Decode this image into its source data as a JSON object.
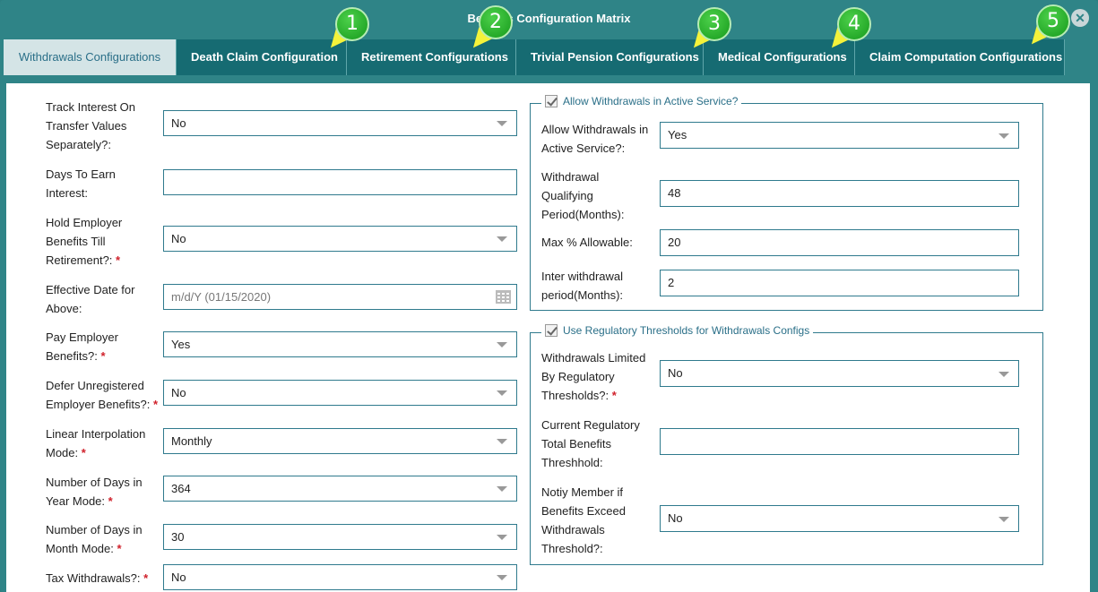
{
  "window": {
    "title": "Benefits Configuration Matrix",
    "close_glyph": "✕"
  },
  "tabs": [
    {
      "label": "Withdrawals Configurations"
    },
    {
      "label": "Death Claim Configuration"
    },
    {
      "label": "Retirement Configurations"
    },
    {
      "label": "Trivial Pension Configurations"
    },
    {
      "label": "Medical Configurations"
    },
    {
      "label": "Claim Computation Configurations"
    }
  ],
  "callouts": [
    "1",
    "2",
    "3",
    "4",
    "5"
  ],
  "left": {
    "track_interest": {
      "label": "Track Interest On Transfer Values Separately?:",
      "value": "No"
    },
    "days_to_earn": {
      "label": "Days To Earn Interest:",
      "value": ""
    },
    "hold_employer": {
      "label": "Hold Employer Benefits Till Retirement?:",
      "value": "No"
    },
    "effective_date": {
      "label": "Effective Date for Above:",
      "placeholder": "m/d/Y (01/15/2020)"
    },
    "pay_employer": {
      "label": "Pay Employer Benefits?:",
      "value": "Yes"
    },
    "defer_unregistered": {
      "label": "Defer Unregistered Employer Benefits?:",
      "value": "No"
    },
    "linear_interp": {
      "label": "Linear Interpolation Mode:",
      "value": "Monthly"
    },
    "days_in_year": {
      "label": "Number of Days in Year Mode:",
      "value": "364"
    },
    "days_in_month": {
      "label": "Number of Days in Month Mode:",
      "value": "30"
    },
    "tax_withdrawals": {
      "label": "Tax Withdrawals?:",
      "value": "No"
    }
  },
  "active_service_group": {
    "legend": "Allow Withdrawals in Active Service?",
    "checked": true,
    "allow": {
      "label": "Allow Withdrawals in Active Service?:",
      "value": "Yes"
    },
    "qualifying": {
      "label": "Withdrawal Qualifying Period(Months):",
      "value": "48"
    },
    "max_pct": {
      "label": "Max % Allowable:",
      "value": "20"
    },
    "inter_period": {
      "label": "Inter withdrawal period(Months):",
      "value": "2"
    }
  },
  "regulatory_group": {
    "legend": "Use Regulatory Thresholds for Withdrawals Configs",
    "checked": true,
    "limited": {
      "label": "Withdrawals Limited By Regulatory Thresholds?:",
      "value": "No"
    },
    "current_threshold": {
      "label": "Current Regulatory Total Benefits Threshhold:",
      "value": ""
    },
    "notify": {
      "label": "Notiy Member if Benefits Exceed Withdrawals Threshold?:",
      "value": "No"
    }
  },
  "required_marker": "*",
  "colors": {
    "header": "#2f8487",
    "tab_dark": "#166b72",
    "tab_active": "#d4e4e6",
    "callout": "#169a1c",
    "arrow": "#f4f23a",
    "required": "#d0212b"
  }
}
